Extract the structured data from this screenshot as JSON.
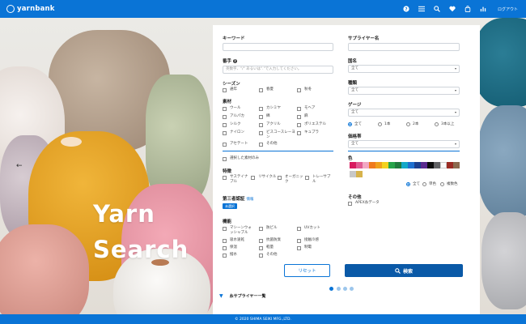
{
  "header": {
    "brand": "yarnbank",
    "logout_label": "ログアウト",
    "icons": [
      "help-icon",
      "list-icon",
      "search-icon",
      "heart-icon",
      "bag-icon",
      "chart-icon"
    ]
  },
  "hero": {
    "title_line1": "Yarn",
    "title_line2": "Search"
  },
  "form": {
    "keyword_label": "キーワード",
    "keyword_value": "",
    "supplier_label": "サプライヤー名",
    "supplier_value": "",
    "count_label": "番手",
    "count_placeholder": "英数字、\"/\" あるいは\".\"で入力してください。",
    "origin_label": "国名",
    "origin_value": "全て",
    "season_label": "シーズン",
    "season_options": [
      "通年",
      "春夏",
      "秋冬"
    ],
    "type_label": "種類",
    "type_value": "全て",
    "material_label": "素材",
    "materials": [
      "ウール",
      "カシミヤ",
      "モヘア",
      "アルパカ",
      "綿",
      "麻",
      "シルク",
      "アクリル",
      "ポリエステル",
      "ナイロン",
      "ビスコースレーヨン",
      "キュプラ",
      "アセテート",
      "その他"
    ],
    "gauge_label": "ゲージ",
    "gauge_value": "全て",
    "ply_options": [
      "全て",
      "1本",
      "2本",
      "3本以上"
    ],
    "price_label": "価格帯",
    "price_value": "全て",
    "selected_only": "選択した素材のみ",
    "color_label": "色",
    "color_swatches": [
      "#d81a5f",
      "#e05b92",
      "#f2a7c3",
      "#f07b1d",
      "#f0a11c",
      "#f3d21f",
      "#26a34a",
      "#1f7a3d",
      "#13a8c8",
      "#1e6fd0",
      "#1c3f8f",
      "#5a2b8f",
      "#0c0c0c",
      "#5f6063",
      "#fafafa",
      "#9a2b23",
      "#8b6a4e",
      "#c8c8c8",
      "#d7b34c"
    ],
    "color_type_options": [
      "全て",
      "単色",
      "複数色"
    ],
    "features_label": "特徴",
    "features": [
      "サステイナブル",
      "リサイクル",
      "オーガニック",
      "トレーサブル"
    ],
    "cert_label": "第三者認証",
    "cert_info": "情報",
    "cert_badge": "未選択",
    "other_label": "その他",
    "other_options": [
      "APEX糸データ"
    ],
    "function_label": "機能",
    "functions": [
      "マシーンウォッシャブル",
      "防ピル",
      "UVカット",
      "吸水速乾",
      "抗菌防臭",
      "接触冷感",
      "保温",
      "軽量",
      "制電",
      "撥水",
      "その他"
    ],
    "reset_label": "リセット",
    "search_label": "検索"
  },
  "supplier_list_label": "糸サプライヤー一覧",
  "footer": {
    "copyright": "© 2020 SHIMA SEIKI MFG.,LTD."
  }
}
